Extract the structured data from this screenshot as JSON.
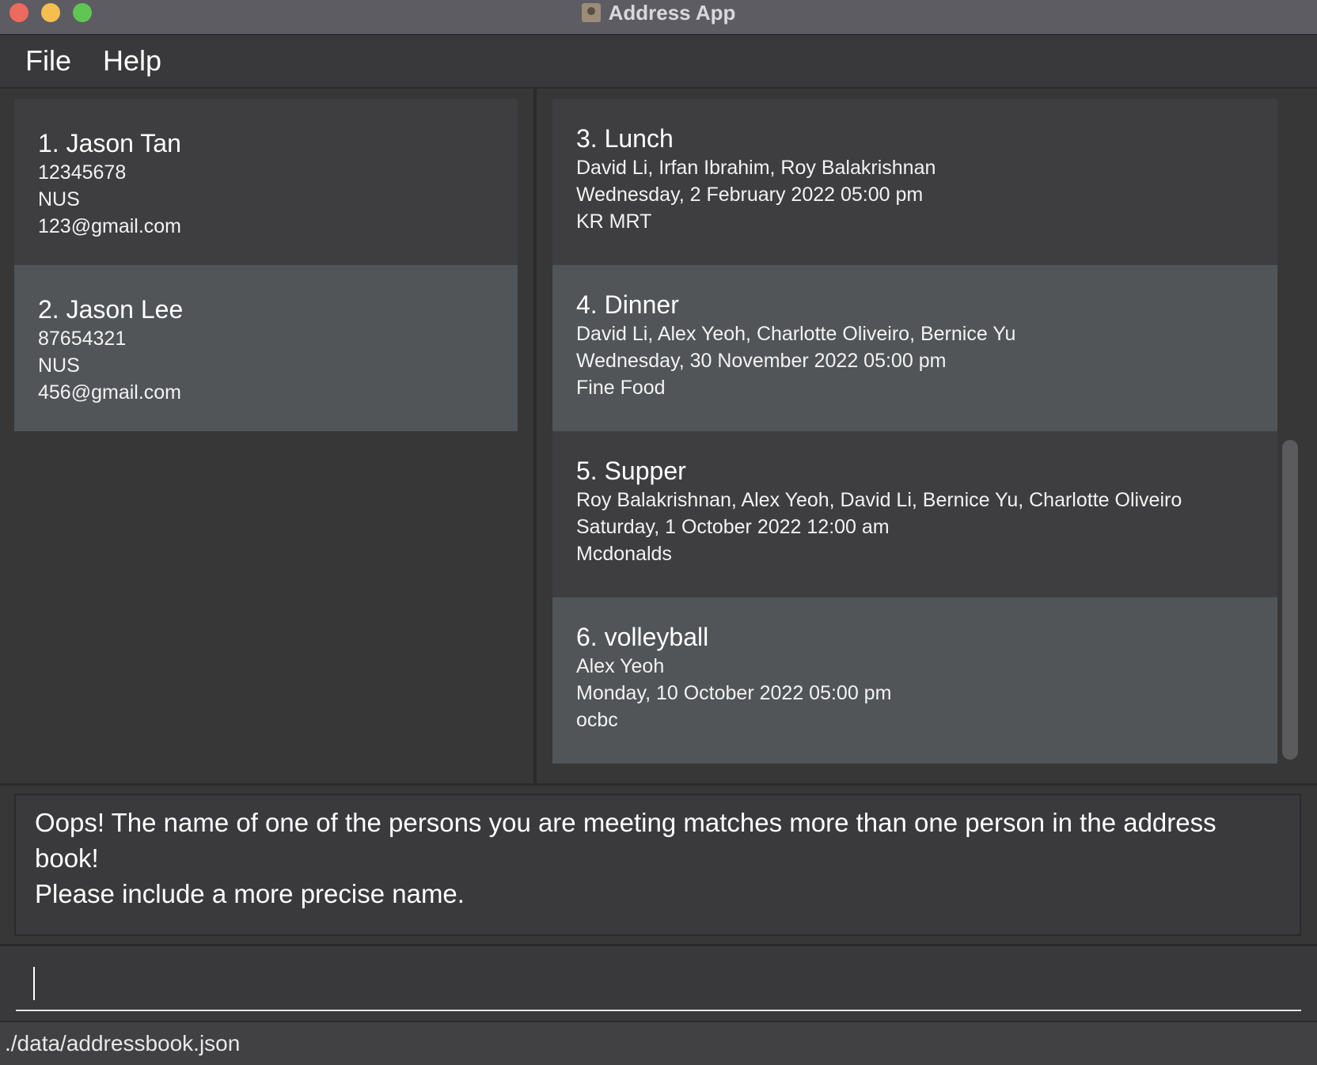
{
  "window": {
    "title": "Address App"
  },
  "menu": {
    "items": [
      {
        "label": "File"
      },
      {
        "label": "Help"
      }
    ]
  },
  "persons": [
    {
      "name": "1.  Jason Tan",
      "phone": "12345678",
      "address": "NUS",
      "email": "123@gmail.com"
    },
    {
      "name": "2.  Jason Lee",
      "phone": "87654321",
      "address": "NUS",
      "email": "456@gmail.com"
    }
  ],
  "events": [
    {
      "title": "3.  Lunch",
      "people": "David Li, Irfan Ibrahim, Roy Balakrishnan",
      "datetime": "Wednesday, 2 February 2022 05:00 pm",
      "location": "KR MRT"
    },
    {
      "title": "4.  Dinner",
      "people": "David Li, Alex Yeoh, Charlotte Oliveiro, Bernice Yu",
      "datetime": "Wednesday, 30 November 2022 05:00 pm",
      "location": "Fine Food"
    },
    {
      "title": "5.  Supper",
      "people": "Roy Balakrishnan, Alex Yeoh, David Li, Bernice Yu, Charlotte Oliveiro",
      "datetime": "Saturday, 1 October 2022 12:00 am",
      "location": "Mcdonalds"
    },
    {
      "title": "6.  volleyball",
      "people": "Alex Yeoh",
      "datetime": "Monday, 10 October 2022 05:00 pm",
      "location": "ocbc"
    }
  ],
  "result": {
    "message": "Oops! The name of one of the persons you are meeting matches more than one person in the address book!\nPlease include a more precise name."
  },
  "command": {
    "value": ""
  },
  "status": {
    "file_path": "./data/addressbook.json"
  },
  "colors": {
    "close": "#ed6a5e",
    "minimize": "#f5bf4f",
    "maximize": "#61c554"
  }
}
